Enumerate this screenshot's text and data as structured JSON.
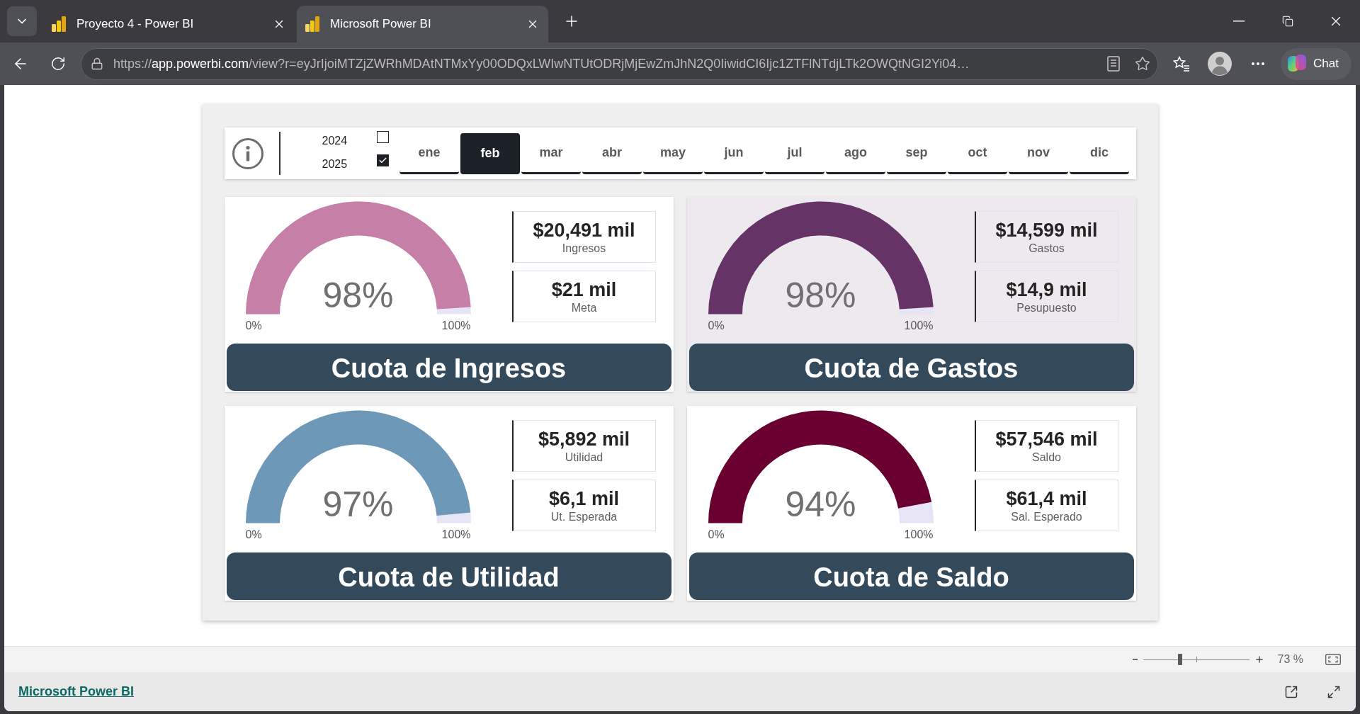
{
  "browser": {
    "tabs": [
      {
        "title": "Proyecto 4 - Power BI",
        "selected": false
      },
      {
        "title": "Microsoft Power BI",
        "selected": true
      }
    ],
    "address": {
      "scheme": "https://",
      "host": "app.powerbi.com",
      "path": "/view?r=eyJrIjoiMTZjZWRhMDAtNTMxYy00ODQxLWIwNTUtODRjMjEwZmJhN2Q0IiwidCI6Ijc1ZTFlNTdjLTk2OWQtNGI2Yi04…"
    },
    "chat_button": "Chat"
  },
  "report": {
    "years": [
      {
        "label": "2024",
        "checked": false
      },
      {
        "label": "2025",
        "checked": true
      }
    ],
    "months": [
      {
        "label": "ene",
        "selected": false
      },
      {
        "label": "feb",
        "selected": true
      },
      {
        "label": "mar",
        "selected": false
      },
      {
        "label": "abr",
        "selected": false
      },
      {
        "label": "may",
        "selected": false
      },
      {
        "label": "jun",
        "selected": false
      },
      {
        "label": "jul",
        "selected": false
      },
      {
        "label": "ago",
        "selected": false
      },
      {
        "label": "sep",
        "selected": false
      },
      {
        "label": "oct",
        "selected": false
      },
      {
        "label": "nov",
        "selected": false
      },
      {
        "label": "dic",
        "selected": false
      }
    ],
    "cards": [
      {
        "title": "Cuota de Ingresos",
        "reading": "98%",
        "level": 0.98,
        "color": "#c680a8",
        "shaded": false,
        "scale_min": "0%",
        "scale_max": "100%",
        "kpis": [
          {
            "value": "$20,491 mil",
            "label": "Ingresos"
          },
          {
            "value": "$21 mil",
            "label": "Meta"
          }
        ]
      },
      {
        "title": "Cuota de Gastos",
        "reading": "98%",
        "level": 0.98,
        "color": "#663366",
        "shaded": true,
        "scale_min": "0%",
        "scale_max": "100%",
        "kpis": [
          {
            "value": "$14,599 mil",
            "label": "Gastos"
          },
          {
            "value": "$14,9 mil",
            "label": "Pesupuesto"
          }
        ]
      },
      {
        "title": "Cuota de Utilidad",
        "reading": "97%",
        "level": 0.97,
        "color": "#6d98b8",
        "shaded": false,
        "scale_min": "0%",
        "scale_max": "100%",
        "kpis": [
          {
            "value": "$5,892 mil",
            "label": "Utilidad"
          },
          {
            "value": "$6,1 mil",
            "label": "Ut. Esperada"
          }
        ]
      },
      {
        "title": "Cuota de Saldo",
        "reading": "94%",
        "level": 0.94,
        "color": "#6a0030",
        "shaded": false,
        "scale_min": "0%",
        "scale_max": "100%",
        "kpis": [
          {
            "value": "$57,546 mil",
            "label": "Saldo"
          },
          {
            "value": "$61,4 mil",
            "label": "Sal. Esperado"
          }
        ]
      }
    ]
  },
  "footer": {
    "zoom": {
      "level": 0.35,
      "reading": "73 %"
    },
    "link": "Microsoft Power BI"
  }
}
